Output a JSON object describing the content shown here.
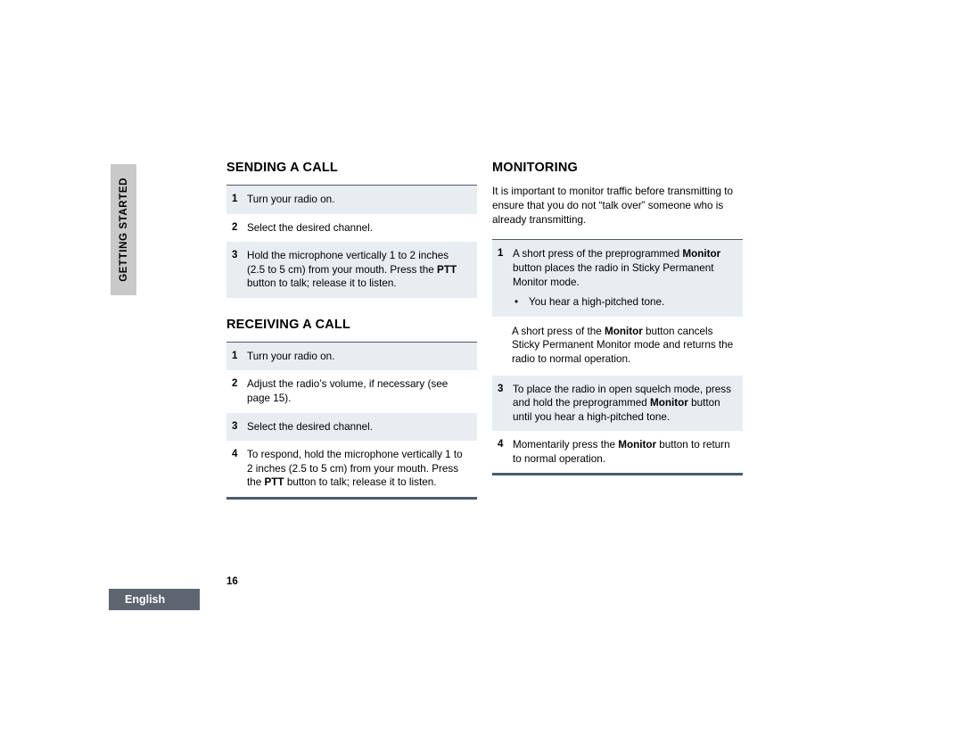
{
  "side_tab": {
    "label": "GETTING STARTED"
  },
  "footer": {
    "language": "English",
    "page_number": "16"
  },
  "left_column": {
    "sending": {
      "title": "SENDING A CALL",
      "steps": [
        {
          "num": "1",
          "text": "Turn your radio on."
        },
        {
          "num": "2",
          "text": "Select the desired channel."
        },
        {
          "num": "3",
          "text_a": "Hold the microphone vertically 1 to 2 inches (2.5 to 5 cm) from your mouth. Press the ",
          "bold": "PTT",
          "text_b": " button to talk; release it to listen."
        }
      ]
    },
    "receiving": {
      "title": "RECEIVING A CALL",
      "steps": [
        {
          "num": "1",
          "text": "Turn your radio on."
        },
        {
          "num": "2",
          "text": "Adjust the radio’s volume, if necessary (see page 15)."
        },
        {
          "num": "3",
          "text": "Select the desired channel."
        },
        {
          "num": "4",
          "text_a": "To respond, hold the microphone vertically 1 to 2 inches (2.5 to 5 cm) from your mouth. Press the ",
          "bold": "PTT",
          "text_b": " button to talk; release it to listen."
        }
      ]
    }
  },
  "right_column": {
    "monitoring": {
      "title": "MONITORING",
      "intro": "It is important to monitor traffic before transmitting to ensure that you do not “talk over” someone who is already transmitting.",
      "step1": {
        "num": "1",
        "text_a": "A short press of the preprogrammed ",
        "bold": "Monitor",
        "text_b": " button places the radio in Sticky Permanent Monitor mode.",
        "bullet": "You hear a high-pitched tone."
      },
      "step2": {
        "text_a": "A short press of the ",
        "bold": "Monitor",
        "text_b": " button cancels Sticky Permanent Monitor mode and returns the radio to normal operation."
      },
      "step3": {
        "num": "3",
        "text_a": "To place the radio in open squelch mode, press and hold the preprogrammed ",
        "bold": "Monitor",
        "text_b": " button until you hear a high-pitched tone."
      },
      "step4": {
        "num": "4",
        "text_a": "Momentarily press the ",
        "bold": "Monitor",
        "text_b": " button to return to normal operation."
      }
    }
  },
  "colors": {
    "shade": "#e8edf2",
    "rule": "#4b5c6b",
    "tab_bg": "#c9c9c9",
    "badge_bg": "#5d6670"
  }
}
